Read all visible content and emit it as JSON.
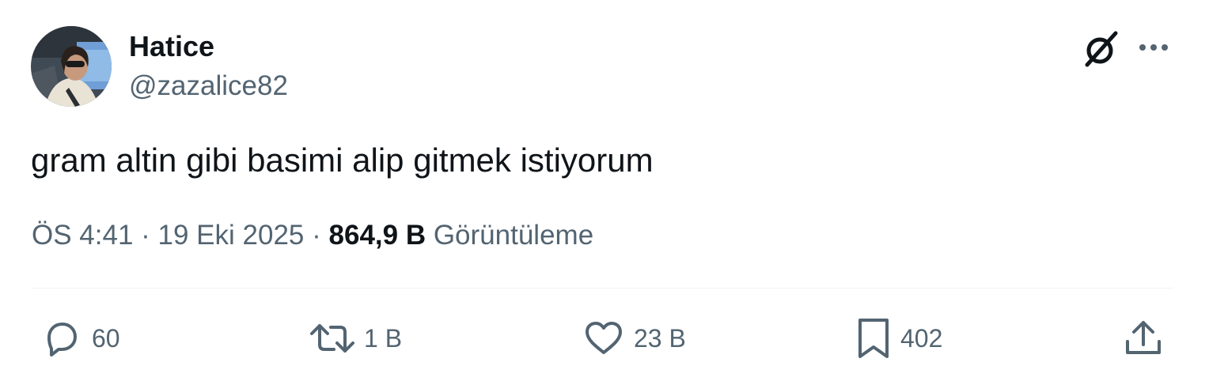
{
  "author": {
    "display_name": "Hatice",
    "handle": "@zazalice82"
  },
  "tweet": {
    "text": "gram altin gibi basimi alip gitmek istiyorum"
  },
  "meta": {
    "time": "ÖS 4:41",
    "separator_1": " · ",
    "date": "19 Eki 2025",
    "separator_2": " · ",
    "views_count": "864,9 B",
    "views_label": " Görüntüleme"
  },
  "actions": {
    "replies": "60",
    "reposts": "1 B",
    "likes": "23 B",
    "bookmarks": "402"
  },
  "icons": {
    "header": [
      "grok-icon",
      "more-icon"
    ],
    "actions": [
      "reply-icon",
      "repost-icon",
      "like-icon",
      "bookmark-icon",
      "share-icon"
    ]
  },
  "colors": {
    "text_primary": "#0f1419",
    "text_secondary": "#536471",
    "divider": "#eff3f4",
    "background": "#ffffff"
  }
}
